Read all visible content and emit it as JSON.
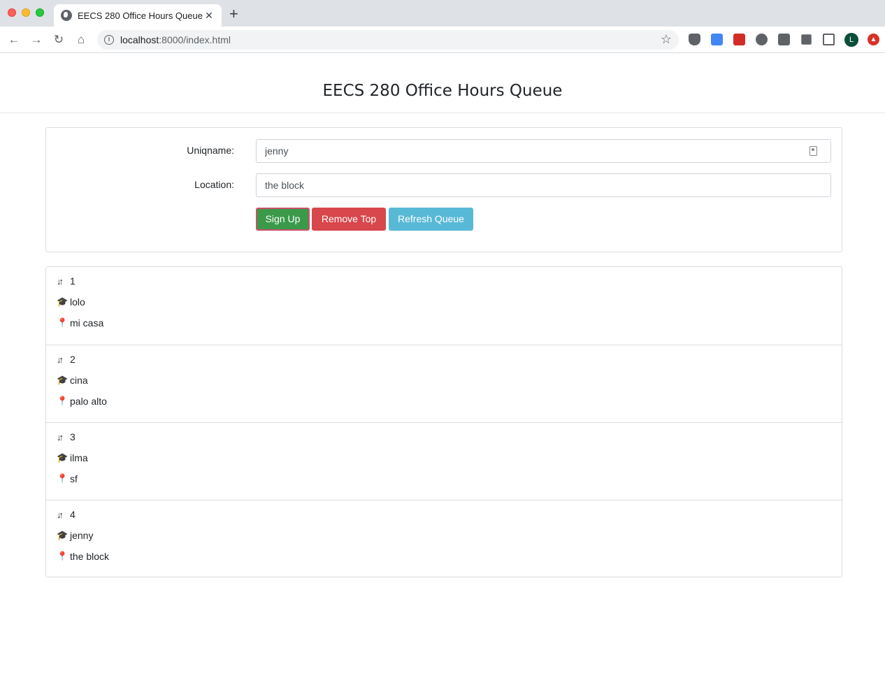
{
  "browser": {
    "tab_title": "EECS 280 Office Hours Queue",
    "new_tab": "+",
    "close": "✕",
    "url_host": "localhost",
    "url_path": ":8000/index.html",
    "avatar_initial": "L"
  },
  "page": {
    "title": "EECS 280 Office Hours Queue"
  },
  "form": {
    "uniqname_label": "Uniqname:",
    "uniqname_value": "jenny",
    "location_label": "Location:",
    "location_value": "the block",
    "signup_label": "Sign Up",
    "remove_label": "Remove Top",
    "refresh_label": "Refresh Queue"
  },
  "colors": {
    "signup": "#3a9a4a",
    "remove": "#d7474b",
    "refresh": "#58b9d6"
  },
  "queue": [
    {
      "position": "1",
      "uniqname": "lolo",
      "location": "mi casa"
    },
    {
      "position": "2",
      "uniqname": "cina",
      "location": "palo alto"
    },
    {
      "position": "3",
      "uniqname": "ilma",
      "location": "sf"
    },
    {
      "position": "4",
      "uniqname": "jenny",
      "location": "the block"
    }
  ],
  "icons": {
    "position": "sort-icon",
    "uniqname": "graduation-cap-icon",
    "location": "map-marker-icon"
  }
}
